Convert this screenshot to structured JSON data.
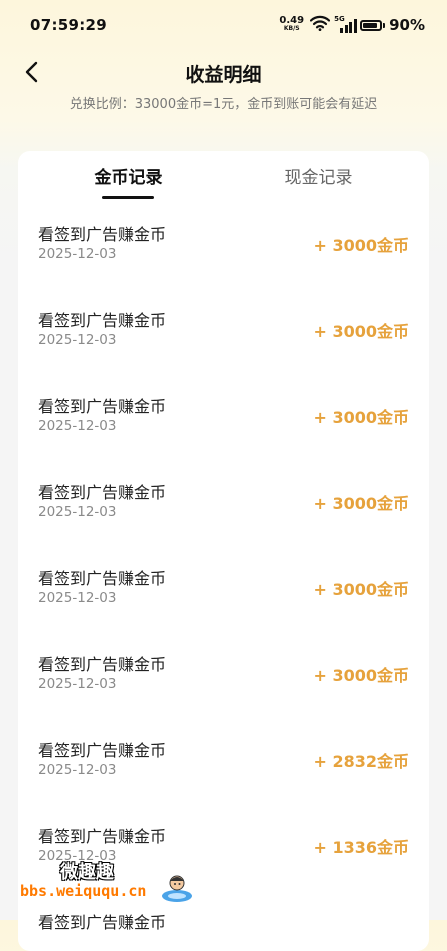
{
  "status_bar": {
    "time": "07:59:29",
    "net_speed_value": "0.49",
    "net_speed_unit": "KB/S",
    "network_type": "5G",
    "battery": "90%"
  },
  "header": {
    "back_icon": "chevron-left-icon",
    "title": "收益明细",
    "subtitle": "兑换比例：33000金币=1元，金币到账可能会有延迟"
  },
  "tabs": [
    {
      "label": "金币记录",
      "active": true
    },
    {
      "label": "现金记录",
      "active": false
    }
  ],
  "records": [
    {
      "name": "看签到广告赚金币",
      "date": "2025-12-03",
      "amount": "+ 3000金币"
    },
    {
      "name": "看签到广告赚金币",
      "date": "2025-12-03",
      "amount": "+ 3000金币"
    },
    {
      "name": "看签到广告赚金币",
      "date": "2025-12-03",
      "amount": "+ 3000金币"
    },
    {
      "name": "看签到广告赚金币",
      "date": "2025-12-03",
      "amount": "+ 3000金币"
    },
    {
      "name": "看签到广告赚金币",
      "date": "2025-12-03",
      "amount": "+ 3000金币"
    },
    {
      "name": "看签到广告赚金币",
      "date": "2025-12-03",
      "amount": "+ 3000金币"
    },
    {
      "name": "看签到广告赚金币",
      "date": "2025-12-03",
      "amount": "+ 2832金币"
    },
    {
      "name": "看签到广告赚金币",
      "date": "2025-12-03",
      "amount": "+ 1336金币"
    },
    {
      "name": "看签到广告赚金币",
      "date": "",
      "amount": ""
    }
  ],
  "watermark": {
    "text_cn": "微趣趣",
    "url": "bbs.weiququ.cn"
  },
  "colors": {
    "amount": "#e6a23c",
    "header_gradient_top": "#fdf6dc",
    "background": "#f5f5f5"
  }
}
